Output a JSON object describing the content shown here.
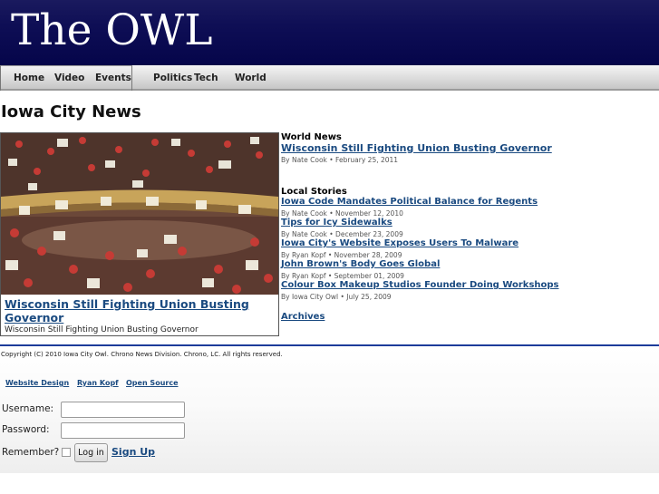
{
  "site": {
    "title": "The OWL"
  },
  "nav": {
    "items": [
      "Home",
      "Video",
      "Events",
      "Politics",
      "Tech",
      "World"
    ]
  },
  "page": {
    "heading": "Iowa City News"
  },
  "feature": {
    "image": "protest-crowd-photo",
    "title": "Wisconsin Still Fighting Union Busting Governor",
    "subtitle": "Wisconsin Still Fighting Union Busting Governor"
  },
  "world_news": {
    "label": "World News",
    "story": {
      "title": "Wisconsin Still Fighting Union Busting Governor",
      "byline": "By Nate Cook • February 25, 2011"
    }
  },
  "local_stories": {
    "label": "Local Stories",
    "items": [
      {
        "title": "Iowa Code Mandates Political Balance for Regents",
        "byline": "By Nate Cook • November 12, 2010"
      },
      {
        "title": "Tips for Icy Sidewalks",
        "byline": "By Nate Cook • December 23, 2009"
      },
      {
        "title": "Iowa City's Website Exposes Users To Malware",
        "byline": "By Ryan Kopf • November 28, 2009"
      },
      {
        "title": "John Brown's Body Goes Global",
        "byline": "By Ryan Kopf • September 01, 2009"
      },
      {
        "title": "Colour Box Makeup Studios Founder Doing Workshops",
        "byline": "By Iowa City Owl • July 25, 2009"
      }
    ],
    "archives": "Archives"
  },
  "footer": {
    "copyright": "Copyright (C) 2010 Iowa City Owl. Chrono News Division. Chrono, LC. All rights reserved.",
    "credits": [
      "Website Design",
      "Ryan Kopf",
      "Open Source"
    ]
  },
  "login": {
    "username_label": "Username:",
    "username_value": "",
    "password_label": "Password:",
    "password_value": "",
    "remember_label": "Remember?",
    "login_button": "Log in",
    "signup_link": "Sign Up"
  },
  "colors": {
    "masthead": "#0e0e55",
    "link": "#1a4a80",
    "footer_rule": "#1d3c9a"
  }
}
